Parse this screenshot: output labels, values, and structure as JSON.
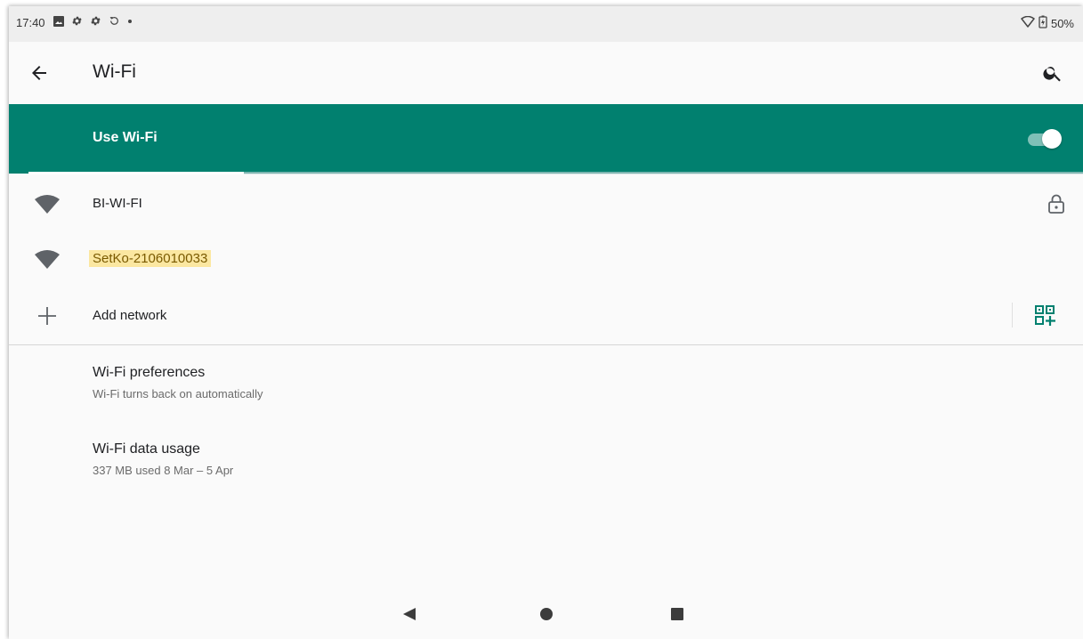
{
  "status": {
    "time": "17:40",
    "battery": "50%",
    "icons": [
      "image-icon",
      "gear-icon",
      "gear-icon",
      "sync-icon",
      "dot-icon"
    ]
  },
  "appbar": {
    "title": "Wi-Fi"
  },
  "master_switch": {
    "label": "Use Wi-Fi",
    "on": true
  },
  "networks": [
    {
      "name": "BI-WI-FI",
      "secured": true,
      "highlighted": false
    },
    {
      "name": "SetKo-2106010033",
      "secured": false,
      "highlighted": true
    }
  ],
  "add_network": {
    "label": "Add network"
  },
  "preferences": {
    "title": "Wi-Fi preferences",
    "summary": "Wi-Fi turns back on automatically"
  },
  "data_usage": {
    "title": "Wi-Fi data usage",
    "summary": "337 MB used 8 Mar – 5 Apr"
  },
  "colors": {
    "accent": "#01806f",
    "highlight": "#fbe7a1"
  }
}
